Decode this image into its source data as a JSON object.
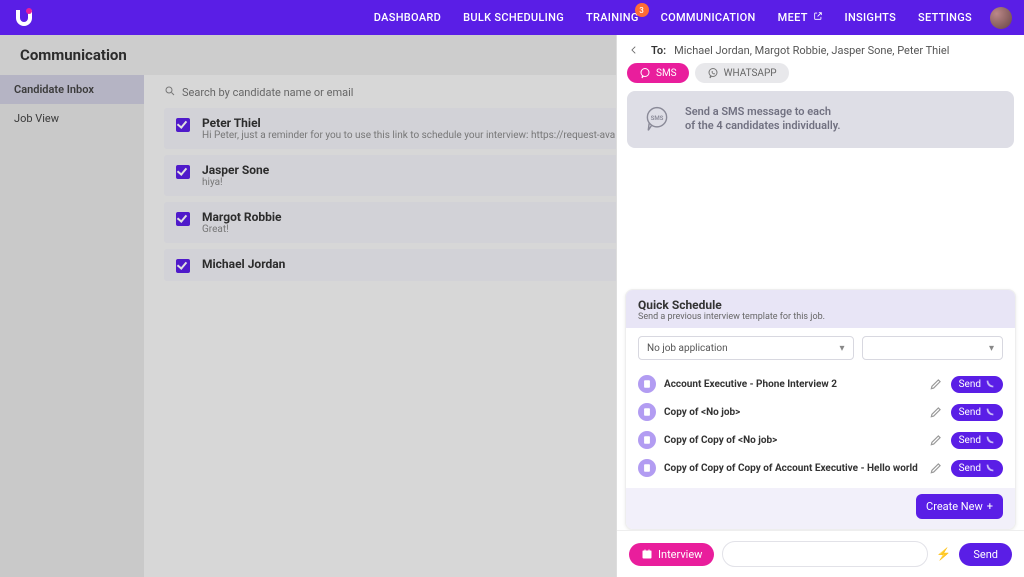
{
  "colors": {
    "primary": "#5a1ee6",
    "accent": "#e91e9c"
  },
  "nav": {
    "items": [
      {
        "label": "DASHBOARD"
      },
      {
        "label": "BULK SCHEDULING"
      },
      {
        "label": "TRAINING",
        "badge": "3"
      },
      {
        "label": "COMMUNICATION"
      },
      {
        "label": "MEET"
      },
      {
        "label": "INSIGHTS"
      },
      {
        "label": "SETTINGS"
      }
    ]
  },
  "page_title": "Communication",
  "sidebar": {
    "items": [
      {
        "label": "Candidate Inbox",
        "active": true
      },
      {
        "label": "Job View",
        "active": false
      }
    ]
  },
  "search_placeholder": "Search by candidate name or email",
  "candidates": [
    {
      "name": "Peter Thiel",
      "preview": "Hi Peter, just a reminder for you to use this link to schedule your interview: https://request-availability.goodtime.io/intro/HmfgpE"
    },
    {
      "name": "Jasper Sone",
      "preview": "hiya!"
    },
    {
      "name": "Margot Robbie",
      "preview": "Great!"
    },
    {
      "name": "Michael Jordan",
      "preview": ""
    }
  ],
  "panel": {
    "to_label": "To:",
    "to_value": "Michael Jordan, Margot Robbie, Jasper Sone, Peter Thiel",
    "tabs": {
      "sms": "SMS",
      "whatsapp": "WHATSAPP"
    },
    "info_line1": "Send a SMS message to each",
    "info_line2": "of the 4 candidates individually.",
    "quick": {
      "title": "Quick Schedule",
      "subtitle": "Send a previous interview template for this job.",
      "select1": "No job application",
      "select2": "",
      "templates": [
        {
          "label": "Account Executive - Phone Interview 2",
          "send": "Send"
        },
        {
          "label": "Copy of <No job>",
          "send": "Send"
        },
        {
          "label": "Copy of Copy of <No job>",
          "send": "Send"
        },
        {
          "label": "Copy of Copy of Copy of Account Executive - Hello world",
          "send": "Send"
        }
      ],
      "create_label": "Create New"
    },
    "compose": {
      "interview_label": "Interview",
      "send_label": "Send"
    }
  }
}
